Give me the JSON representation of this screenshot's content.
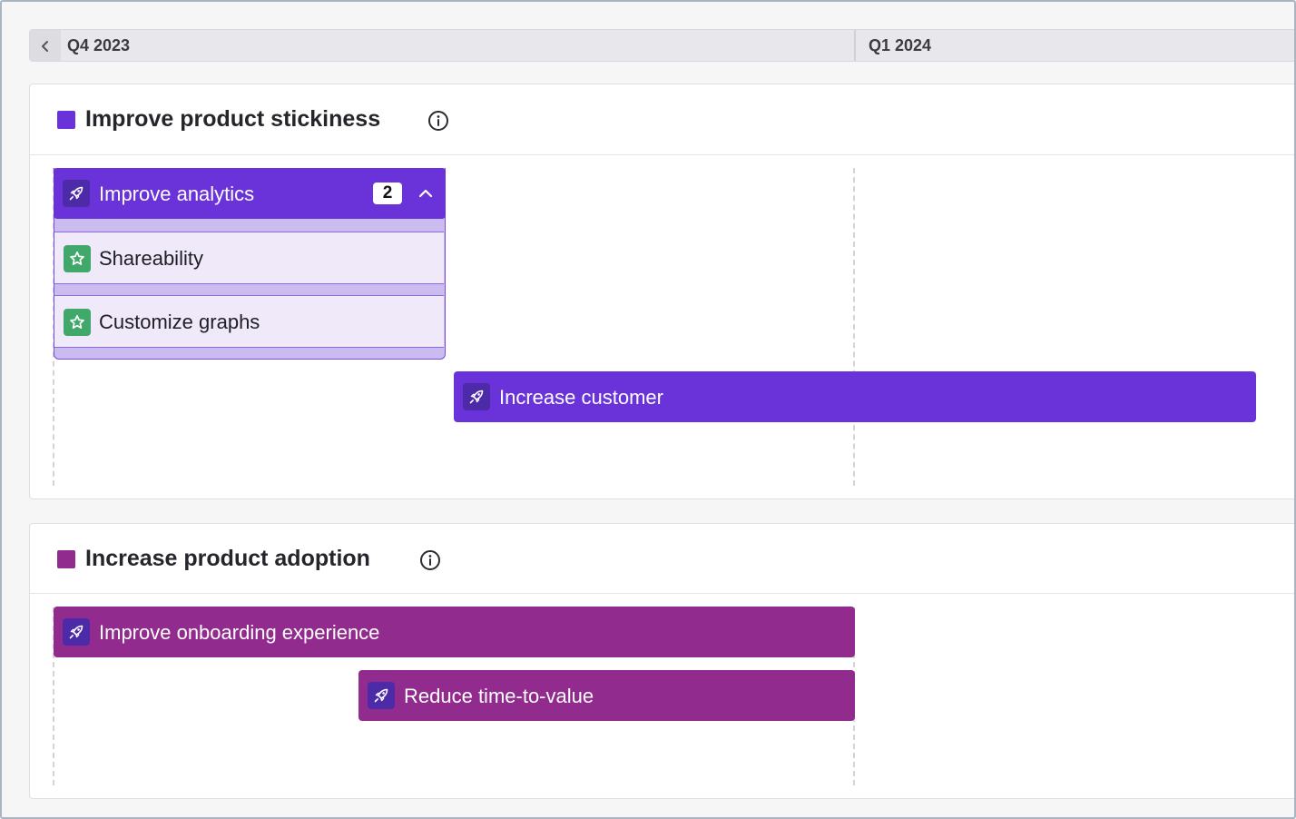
{
  "timeline": {
    "quarters": [
      "Q4 2023",
      "Q1 2024"
    ]
  },
  "colors": {
    "stickiness": "#6a33d9",
    "adoption": "#922b8e",
    "feature_green": "#3fa86a",
    "initiative_icon_bg": "#4c2aa8"
  },
  "objectives": [
    {
      "title": "Improve product stickiness",
      "initiatives": [
        {
          "label": "Improve analytics",
          "count": "2",
          "expanded": true,
          "icon": "rocket-icon",
          "children": [
            {
              "label": "Shareability",
              "icon": "star-icon"
            },
            {
              "label": "Customize graphs",
              "icon": "star-icon"
            }
          ]
        },
        {
          "label": "Increase customer",
          "icon": "rocket-icon"
        }
      ]
    },
    {
      "title": "Increase product adoption",
      "initiatives": [
        {
          "label": "Improve onboarding experience",
          "icon": "rocket-icon"
        },
        {
          "label": "Reduce time-to-value",
          "icon": "rocket-icon"
        }
      ]
    }
  ]
}
